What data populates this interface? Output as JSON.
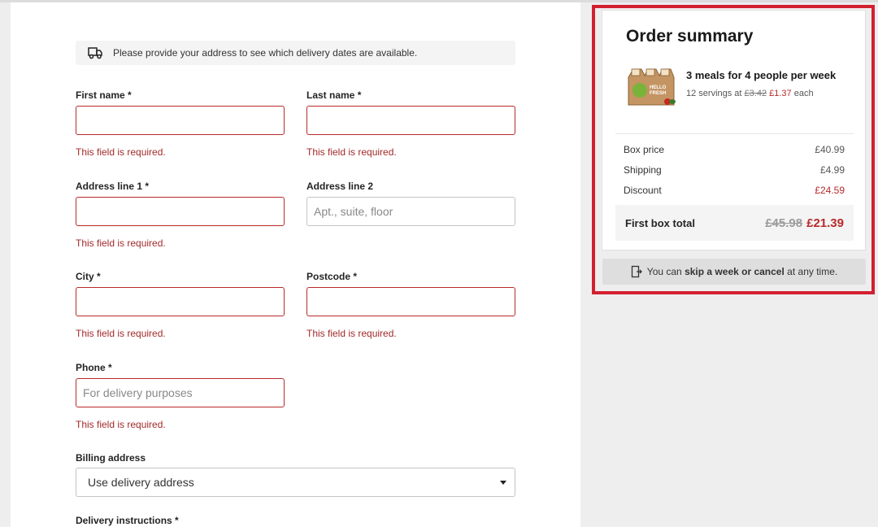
{
  "banner": {
    "icon": "delivery-truck-icon",
    "text": "Please provide your address to see which delivery dates are available."
  },
  "form": {
    "required_error": "This field is required.",
    "first_name": {
      "label": "First name *",
      "value": "",
      "placeholder": ""
    },
    "last_name": {
      "label": "Last name *",
      "value": "",
      "placeholder": ""
    },
    "address1": {
      "label": "Address line 1 *",
      "value": "",
      "placeholder": ""
    },
    "address2": {
      "label": "Address line 2",
      "value": "",
      "placeholder": "Apt., suite, floor"
    },
    "city": {
      "label": "City *",
      "value": "",
      "placeholder": ""
    },
    "postcode": {
      "label": "Postcode *",
      "value": "",
      "placeholder": ""
    },
    "phone": {
      "label": "Phone *",
      "value": "",
      "placeholder": "For delivery purposes"
    },
    "billing": {
      "label": "Billing address",
      "selected": "Use delivery address"
    },
    "delivery_instructions": {
      "label": "Delivery instructions *"
    }
  },
  "summary": {
    "title": "Order summary",
    "image_icon": "meal-box-icon",
    "logo_text_1": "HELLO",
    "logo_text_2": "FRESH",
    "meal_title": "3 meals for 4 people per week",
    "servings_prefix": "12 servings at",
    "old_serving_price": "£3.42",
    "new_serving_price": "£1.37",
    "servings_suffix": "each",
    "rows": [
      {
        "label": "Box price",
        "value": "£40.99",
        "emphasis": false
      },
      {
        "label": "Shipping",
        "value": "£4.99",
        "emphasis": false
      },
      {
        "label": "Discount",
        "value": "£24.59",
        "emphasis": true
      }
    ],
    "total_label": "First box total",
    "total_old": "£45.98",
    "total_new": "£21.39",
    "footer_prefix": "You can",
    "footer_bold": "skip a week or cancel",
    "footer_suffix": "at any time.",
    "footer_icon": "door-exit-icon"
  },
  "colors": {
    "error": "#a32a2a",
    "highlight_outline": "#d32030",
    "price_red": "#b82a2a"
  }
}
